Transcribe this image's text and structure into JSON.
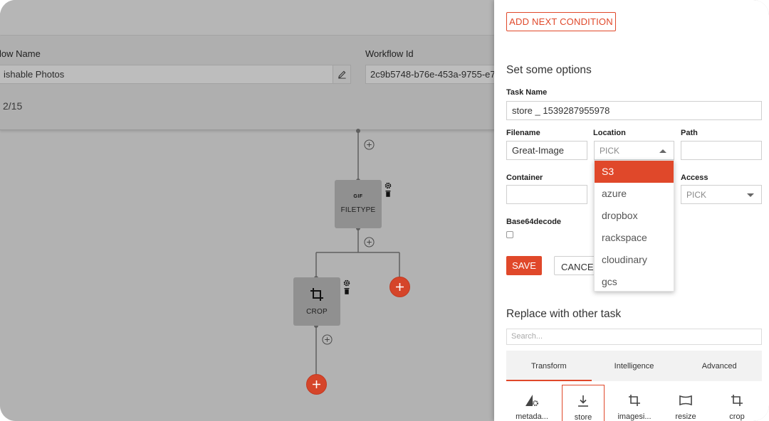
{
  "workflow": {
    "name_label": "low Name",
    "name_value": "ishable Photos",
    "id_label": "Workflow Id",
    "id_value": "2c9b5748-b76e-453a-9755-e7f",
    "counter": "2/15"
  },
  "canvas": {
    "nodes": [
      {
        "label": "FILETYPE",
        "icon": "gif-file-icon",
        "badge": "GIF"
      },
      {
        "label": "CROP",
        "icon": "crop-icon"
      }
    ],
    "accent_color": "#d5452a"
  },
  "panel": {
    "add_condition_label": "ADD NEXT CONDITION",
    "options_title": "Set some options",
    "task_name_label": "Task Name",
    "task_name_value": "store _ 1539287955978",
    "filename_label": "Filename",
    "filename_value": "Great-Image",
    "location_label": "Location",
    "location_value": "PICK",
    "path_label": "Path",
    "path_value": "",
    "container_label": "Container",
    "container_value": "",
    "access_label": "Access",
    "access_value": "PICK",
    "base64_label": "Base64decode",
    "save_label": "SAVE",
    "cancel_label": "CANCEL",
    "location_options": [
      "S3",
      "azure",
      "dropbox",
      "rackspace",
      "cloudinary",
      "gcs"
    ],
    "replace_title": "Replace with other task",
    "search_placeholder": "Search...",
    "tabs": [
      "Transform",
      "Intelligence",
      "Advanced"
    ],
    "tasks": [
      {
        "label": "metada...",
        "icon": "metadata-icon"
      },
      {
        "label": "store",
        "icon": "download-icon"
      },
      {
        "label": "imagesi...",
        "icon": "imagesize-icon"
      },
      {
        "label": "resize",
        "icon": "resize-icon"
      },
      {
        "label": "crop",
        "icon": "crop-icon"
      }
    ],
    "accent_color": "#e0482a"
  }
}
